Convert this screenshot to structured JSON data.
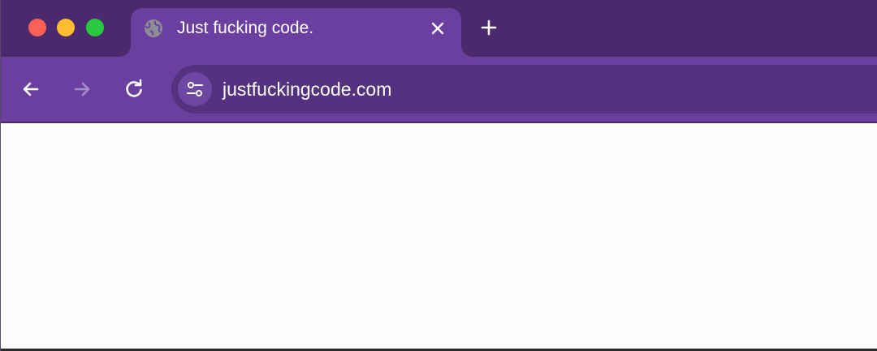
{
  "tab": {
    "title": "Just fucking code.",
    "favicon": "globe-icon",
    "close_icon": "close-icon"
  },
  "new_tab_icon": "plus-icon",
  "nav": {
    "back_icon": "arrow-left-icon",
    "forward_icon": "arrow-right-icon",
    "reload_icon": "reload-icon"
  },
  "omnibox": {
    "site_info_icon": "tune-icon",
    "url": "justfuckingcode.com"
  },
  "colors": {
    "titlebar": "#4a2a6c",
    "tab_active": "#6a3fa0",
    "toolbar": "#6a3fa0",
    "omnibox": "#55327f",
    "content": "#fefefe"
  }
}
